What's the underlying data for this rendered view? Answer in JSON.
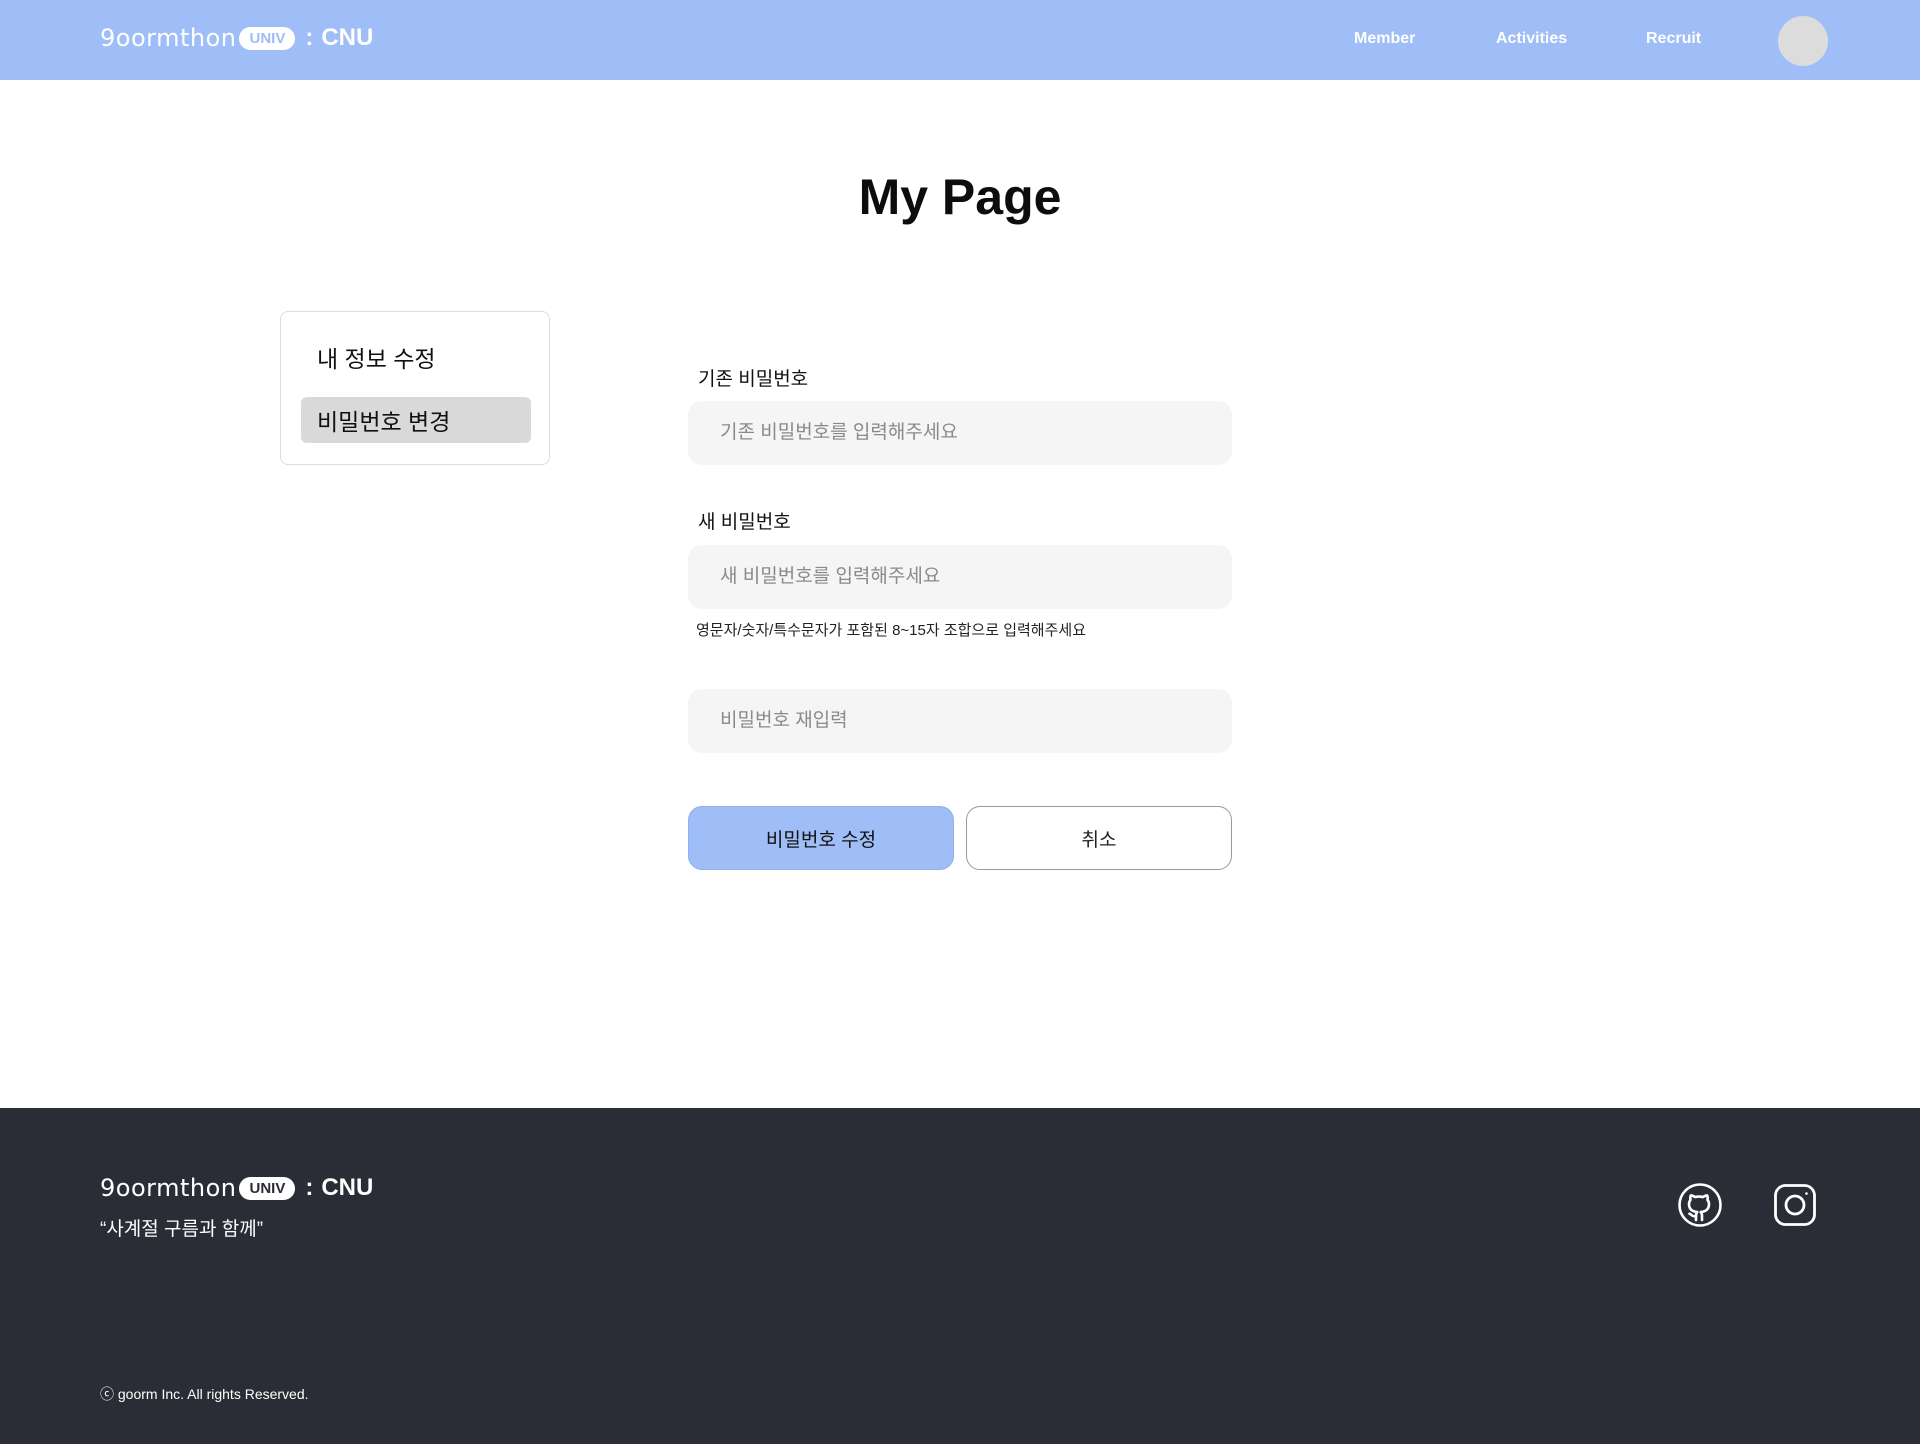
{
  "header": {
    "logo": {
      "word": "9oormthon",
      "pill": "UNIV",
      "separator": ":",
      "school": "CNU"
    },
    "nav": [
      {
        "label": "Member"
      },
      {
        "label": "Activities"
      },
      {
        "label": "Recruit"
      }
    ]
  },
  "page": {
    "title": "My Page"
  },
  "sidebar": {
    "items": [
      {
        "label": "내 정보 수정",
        "active": false
      },
      {
        "label": "비밀번호 변경",
        "active": true
      }
    ]
  },
  "form": {
    "current_label": "기존 비밀번호",
    "current_placeholder": "기존 비밀번호를 입력해주세요",
    "new_label": "새 비밀번호",
    "new_placeholder": "새 비밀번호를 입력해주세요",
    "hint": "영문자/숫자/특수문자가 포함된 8~15자 조합으로 입력해주세요",
    "confirm_placeholder": "비밀번호 재입력",
    "submit_label": "비밀번호 수정",
    "cancel_label": "취소"
  },
  "footer": {
    "logo": {
      "word": "9oormthon",
      "pill": "UNIV",
      "separator": ":",
      "school": "CNU"
    },
    "slogan": "“사계절 구름과 함께”",
    "copyright": "ⓒ goorm Inc. All rights Reserved.",
    "social": [
      "github-icon",
      "instagram-icon"
    ]
  },
  "colors": {
    "header_bg": "#9fbdf6",
    "footer_bg": "#2a2d35",
    "input_bg": "#f5f5f5",
    "active_sidebar_bg": "#d9d9d9"
  }
}
